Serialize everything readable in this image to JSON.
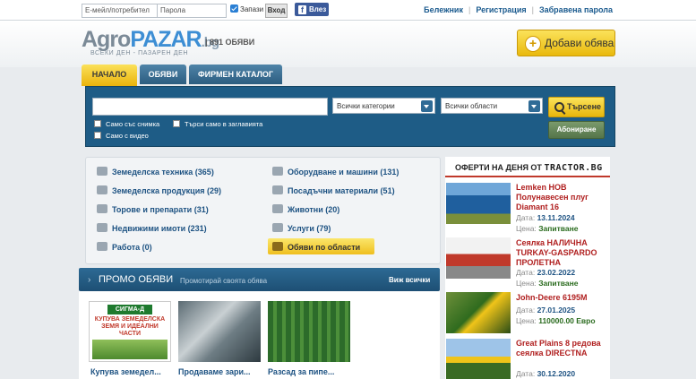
{
  "topbar": {
    "email_placeholder": "Е-мейл/потребител",
    "password_placeholder": "Парола",
    "remember_label": "Запази",
    "login_label": "Вход",
    "fb_login_label": "Влез",
    "links": [
      "Бележник",
      "Регистрация",
      "Забравена парола"
    ]
  },
  "header": {
    "logo_part1": "Agro",
    "logo_part2": "PAZAR",
    "logo_suffix": ".bg",
    "slogan": "ВСЕКИ ДЕН - ПАЗАРЕН ДЕН",
    "ad_count": "| 891 ОБЯВИ",
    "add_button": "Добави обява"
  },
  "tabs": [
    "НАЧАЛО",
    "ОБЯВИ",
    "ФИРМЕН КАТАЛОГ"
  ],
  "search": {
    "category_select": "Всички категории",
    "region_select": "Всички области",
    "search_button": "Търсене",
    "subscribe_button": "Абониране",
    "opt_photo": "Само със снимка",
    "opt_title": "Търси само в заглавията",
    "opt_video": "Само с видео"
  },
  "categories": {
    "left": [
      "Земеделска техника (365)",
      "Земеделска продукция (29)",
      "Торове и препарати (31)",
      "Недвижими имоти (231)",
      "Работа (0)"
    ],
    "right": [
      "Оборудване и машини (131)",
      "Посадъчни материали (51)",
      "Животни (20)",
      "Услуги (79)",
      "Обяви по области"
    ]
  },
  "promo": {
    "title": "ПРОМО ОБЯВИ",
    "subtitle": "Промотирай своята обява",
    "see_all": "Виж всички",
    "items": [
      {
        "caption": "Купува земедел...",
        "sign_top": "СИГМА-Д",
        "sign_body": "КУПУВА ЗЕМЕДЕЛСКА ЗЕМЯ И ИДЕАЛНИ ЧАСТИ"
      },
      {
        "caption": "Продаваме зари..."
      },
      {
        "caption": "Разсад за пипе..."
      }
    ]
  },
  "offers": {
    "heading": "ОФЕРТИ НА ДЕНЯ ОТ",
    "brand": "TRACTOR.BG",
    "date_label": "Дата:",
    "price_label": "Цена:",
    "items": [
      {
        "title": "Lemken НОВ Полунавесен плуг Diamant 16",
        "date": "13.11.2024",
        "price": "Запитване"
      },
      {
        "title": "Сеялка НАЛИЧНА TURKAY-GASPARDO ПРОЛЕТНА",
        "date": "23.02.2022",
        "price": "Запитване"
      },
      {
        "title": "John-Deere 6195M",
        "date": "27.01.2025",
        "price": "110000.00 Евро"
      },
      {
        "title": "Great Plains 8 редова сеялка DIRECTNA",
        "date": "30.12.2020",
        "price": ""
      }
    ]
  },
  "colors": {
    "accent_yellow": "#f5cc2c",
    "primary_blue": "#1e5c86",
    "offer_red": "#b01f1f"
  }
}
